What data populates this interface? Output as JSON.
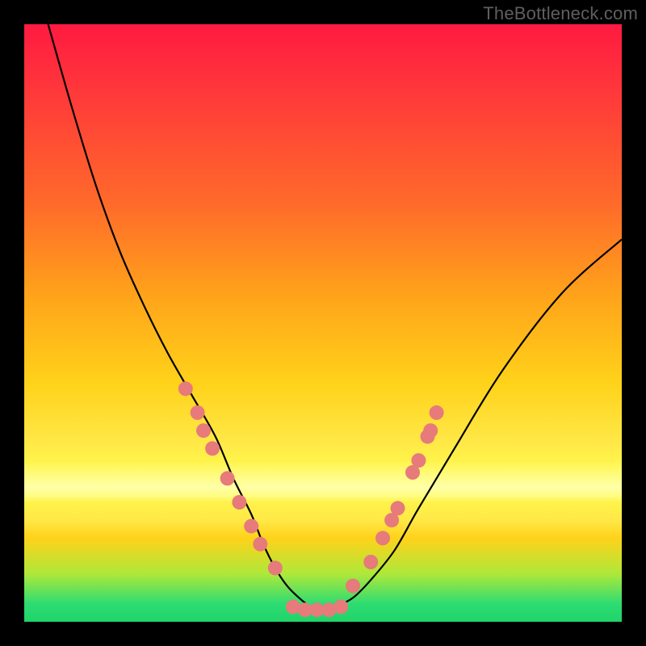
{
  "watermark": "TheBottleneck.com",
  "chart_data": {
    "type": "line",
    "title": "",
    "xlabel": "",
    "ylabel": "",
    "xlim": [
      0,
      100
    ],
    "ylim": [
      0,
      100
    ],
    "series": [
      {
        "name": "bottleneck-curve",
        "x": [
          4,
          8,
          12,
          16,
          20,
          24,
          28,
          32,
          35,
          38,
          40,
          42,
          44,
          46,
          48,
          50,
          52,
          55,
          58,
          62,
          66,
          72,
          80,
          90,
          100
        ],
        "y": [
          100,
          86,
          73,
          62,
          53,
          45,
          38,
          31,
          24,
          18,
          13,
          9,
          6,
          4,
          2.5,
          2,
          2.5,
          4,
          7,
          12,
          19,
          29,
          42,
          55,
          64
        ]
      }
    ],
    "markers": {
      "name": "highlight-dots",
      "color": "#e77a7a",
      "radius_px": 9,
      "points": [
        {
          "x": 27,
          "y": 39
        },
        {
          "x": 29,
          "y": 35
        },
        {
          "x": 30,
          "y": 32
        },
        {
          "x": 31.5,
          "y": 29
        },
        {
          "x": 34,
          "y": 24
        },
        {
          "x": 36,
          "y": 20
        },
        {
          "x": 38,
          "y": 16
        },
        {
          "x": 39.5,
          "y": 13
        },
        {
          "x": 42,
          "y": 9
        },
        {
          "x": 45,
          "y": 2.5
        },
        {
          "x": 47,
          "y": 2
        },
        {
          "x": 49,
          "y": 2
        },
        {
          "x": 51,
          "y": 2
        },
        {
          "x": 53,
          "y": 2.5
        },
        {
          "x": 55,
          "y": 6
        },
        {
          "x": 58,
          "y": 10
        },
        {
          "x": 60,
          "y": 14
        },
        {
          "x": 61.5,
          "y": 17
        },
        {
          "x": 62.5,
          "y": 19
        },
        {
          "x": 65,
          "y": 25
        },
        {
          "x": 66,
          "y": 27
        },
        {
          "x": 67.5,
          "y": 31
        },
        {
          "x": 68,
          "y": 32
        },
        {
          "x": 69,
          "y": 35
        }
      ]
    }
  }
}
